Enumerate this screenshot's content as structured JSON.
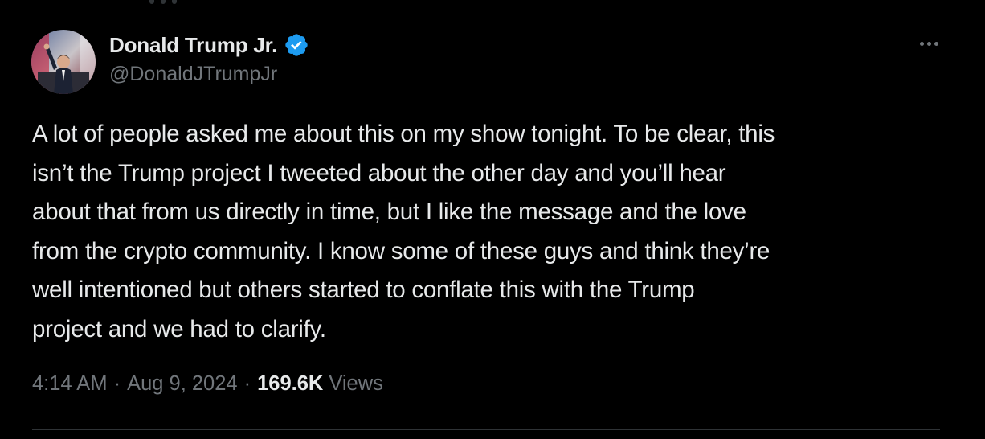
{
  "author": {
    "display_name": "Donald Trump Jr.",
    "handle": "@DonaldJTrumpJr",
    "verified_color": "#1d9bf0"
  },
  "tweet": {
    "text_lines": [
      "A lot of people asked me about this on my show tonight. To be clear, this",
      "isn’t the Trump project I tweeted about the other day and you’ll hear",
      "about that from us directly in time, but I like the message and the love",
      "from the crypto community. I know some of these guys and think they’re",
      "well intentioned but others started to conflate this with the Trump",
      "project and we had to clarify."
    ],
    "time": "4:14 AM",
    "date": "Aug 9, 2024",
    "separator": "·",
    "views_count": "169.6K",
    "views_label": "Views"
  },
  "icons": {
    "more": "more-horizontal-icon",
    "verified": "verified-badge-icon"
  },
  "colors": {
    "background": "#000000",
    "primary_text": "#e7e9ea",
    "secondary_text": "#71767b",
    "divider": "#2f3336",
    "accent": "#1d9bf0"
  }
}
